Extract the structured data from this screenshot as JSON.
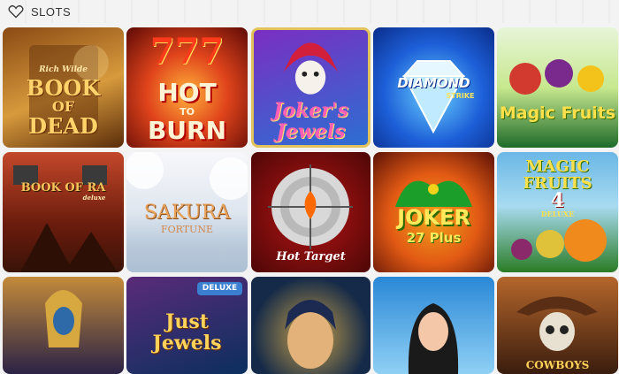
{
  "header": {
    "title": "SLOTS",
    "icon": "heart-outline-icon"
  },
  "tiles": [
    {
      "name": "book-of-dead",
      "line1": "Rich Wilde",
      "line2": "BOOK",
      "line3": "OF",
      "line4": "DEAD",
      "colors": [
        "#8a4a14",
        "#d79a3c"
      ]
    },
    {
      "name": "hot-to-burn",
      "line1": "777",
      "line2": "HOT",
      "line3": "TO",
      "line4": "BURN",
      "colors": [
        "#5e0a06",
        "#e0441b"
      ]
    },
    {
      "name": "jokers-jewels",
      "line1": "Joker's",
      "line2": "Jewels",
      "colors": [
        "#4b1e7a",
        "#2c6fd3"
      ]
    },
    {
      "name": "diamond-strike",
      "line1": "DIAMOND",
      "line2": "STRIKE",
      "colors": [
        "#0a2d8a",
        "#2f9cf2"
      ]
    },
    {
      "name": "magic-fruits",
      "line1": "Magic Fruits",
      "colors": [
        "#1e6b2a",
        "#c7e88e"
      ]
    },
    {
      "name": "book-of-ra-deluxe",
      "line1": "BOOK OF RA",
      "line2": "deluxe",
      "colors": [
        "#3a1308",
        "#c3482a"
      ]
    },
    {
      "name": "sakura-fortune",
      "line1": "SAKURA",
      "line2": "FORTUNE",
      "colors": [
        "#9bb3cc",
        "#f0f0f4"
      ]
    },
    {
      "name": "hot-target",
      "line1": "Hot Target",
      "colors": [
        "#4d0707",
        "#a80e0e"
      ]
    },
    {
      "name": "joker-27-plus",
      "line1": "JOKER",
      "line2": "27 Plus",
      "colors": [
        "#5b1106",
        "#e25a14"
      ]
    },
    {
      "name": "magic-fruits-4-deluxe",
      "line1": "MAGIC",
      "line2": "FRUITS",
      "line3": "4",
      "line4": "DELUXE",
      "colors": [
        "#2a7c25",
        "#6ab7e6"
      ]
    },
    {
      "name": "egyptian-pharaoh",
      "colors": [
        "#2b2346",
        "#c48a3a"
      ]
    },
    {
      "name": "just-jewels-deluxe",
      "line1": "DELUXE",
      "line2": "Just",
      "line3": "Jewels",
      "colors": [
        "#0b2f5e",
        "#5a2b7a"
      ]
    },
    {
      "name": "cleopatra",
      "colors": [
        "#152a48",
        "#c7a14a"
      ]
    },
    {
      "name": "lady-portrait",
      "colors": [
        "#2a88d6",
        "#8fd0f5"
      ]
    },
    {
      "name": "cowboy-skull",
      "line1": "COWBOYS",
      "colors": [
        "#3a1d0e",
        "#b5662b"
      ]
    }
  ]
}
